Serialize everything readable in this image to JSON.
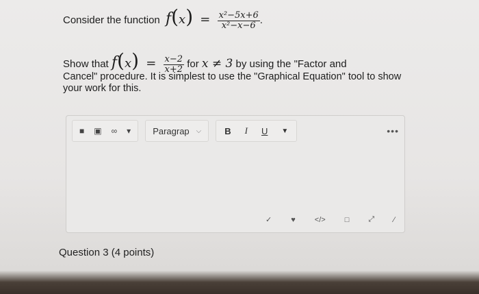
{
  "question": {
    "intro": "Consider the function",
    "fname": "f",
    "var": "x",
    "equals": "=",
    "numerator": "x²−5x+6",
    "denominator": "x²−x−6",
    "period": ".",
    "show_that": "Show that",
    "simpl_num": "x−2",
    "simpl_den": "x+2",
    "for_text": "for",
    "neq": "x ≠ 3",
    "by_text": "by using the \"Factor and",
    "paragraph": "Cancel\" procedure.  It is simplest to use the \"Graphical Equation\" tool to show your work for this."
  },
  "toolbar": {
    "icons": [
      "video-icon",
      "image-icon",
      "link-icon"
    ],
    "paragraph_label": "Paragrap",
    "bold": "B",
    "italic": "I",
    "underline": "U",
    "more": "•••"
  },
  "footer_tools": [
    "spellcheck-icon",
    "accessibility-icon",
    "code-icon",
    "preview-icon",
    "fullscreen-icon",
    "resize-icon"
  ],
  "question3": {
    "label": "Question 3",
    "points": "(4 points)"
  }
}
